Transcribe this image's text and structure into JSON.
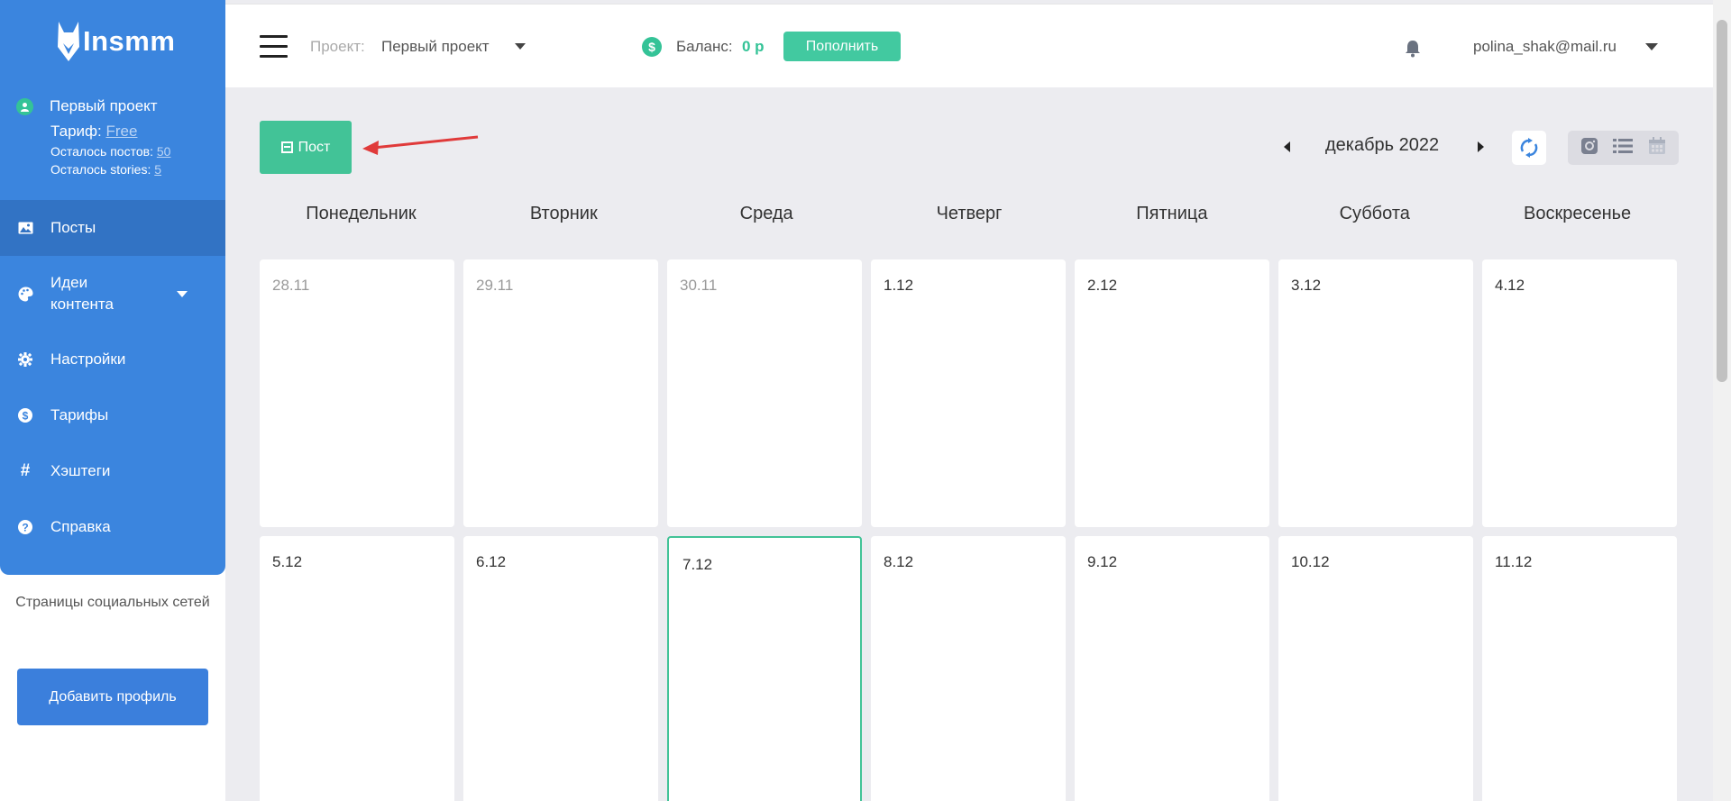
{
  "sidebar": {
    "logo_text": "Insmm",
    "project_name": "Первый проект",
    "tariff_label": "Тариф:",
    "tariff_value": "Free",
    "posts_left_label": "Осталось постов:",
    "posts_left_value": "50",
    "stories_left_label": "Осталось stories:",
    "stories_left_value": "5",
    "nav": [
      {
        "label": "Посты",
        "icon": "image-icon"
      },
      {
        "label": "Идеи контента",
        "icon": "palette-icon"
      },
      {
        "label": "Настройки",
        "icon": "gear-icon"
      },
      {
        "label": "Тарифы",
        "icon": "dollar-icon"
      },
      {
        "label": "Хэштеги",
        "icon": "hashtag-icon"
      },
      {
        "label": "Справка",
        "icon": "help-icon"
      }
    ],
    "social_pages": "Страницы социальных сетей",
    "add_profile": "Добавить профиль"
  },
  "header": {
    "project_label": "Проект:",
    "project_name": "Первый проект",
    "balance_label": "Баланс:",
    "balance_value": "0 р",
    "topup_label": "Пополнить",
    "user_email": "polina_shak@mail.ru"
  },
  "toolbar": {
    "post_label": "Пост",
    "month": "декабрь 2022"
  },
  "calendar": {
    "weekdays": [
      "Понедельник",
      "Вторник",
      "Среда",
      "Четверг",
      "Пятница",
      "Суббота",
      "Воскресенье"
    ],
    "weeks": [
      [
        "28.11",
        "29.11",
        "30.11",
        "1.12",
        "2.12",
        "3.12",
        "4.12"
      ],
      [
        "5.12",
        "6.12",
        "7.12",
        "8.12",
        "9.12",
        "10.12",
        "11.12"
      ]
    ]
  },
  "colors": {
    "sidebar_blue": "#3b85de",
    "accent_green": "#42c397",
    "arrow_red": "#e03a3a"
  }
}
